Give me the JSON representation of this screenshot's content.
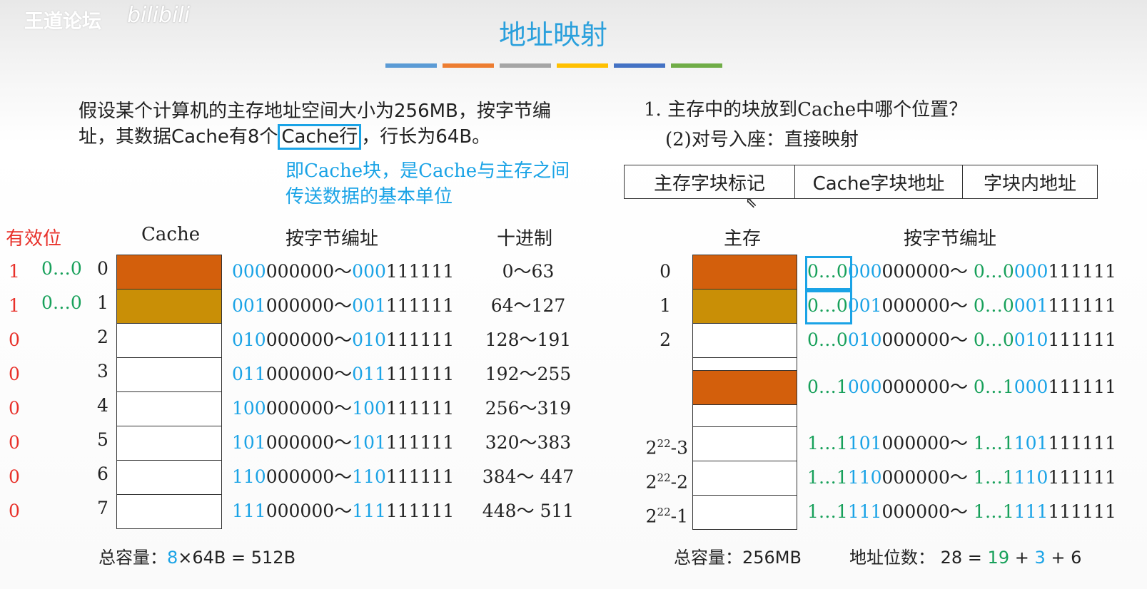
{
  "watermark": {
    "site": "王道论坛",
    "logo": "bilibili"
  },
  "title": "地址映射",
  "colors": {
    "blue": "#1aa3e6",
    "green": "#17a05a",
    "red": "#e8312a",
    "orange": "#d35f0c",
    "gold": "#c98f06",
    "bars": [
      "#5b9bd5",
      "#ed7d31",
      "#a5a5a5",
      "#ffc000",
      "#4472c4",
      "#70ad47"
    ]
  },
  "intro": {
    "line1": "假设某个计算机的主存地址空间大小为256MB，按字节编",
    "line2_pre": "址，其数据Cache有8个",
    "line2_hl": "Cache行",
    "line2_post": "，行长为64B。"
  },
  "note": {
    "line1": "即Cache块，是Cache与主存之间",
    "line2": "传送数据的基本单位"
  },
  "question": {
    "q1": "1. 主存中的块放到Cache中哪个位置？",
    "q2": "(2)对号入座：直接映射"
  },
  "format": [
    "主存字块标记",
    "Cache字块地址",
    "字块内地址"
  ],
  "left_headers": {
    "valid": "有效位",
    "cache": "Cache",
    "addr": "按字节编址",
    "dec": "十进制"
  },
  "cache_rows": [
    {
      "valid": "1",
      "tag": "0…0",
      "idx": "0",
      "fill": "orange",
      "a": [
        [
          "000",
          "b"
        ],
        [
          "000000",
          "k"
        ]
      ],
      "b": [
        [
          "000",
          "b"
        ],
        [
          "111111",
          "k"
        ]
      ],
      "dec": "0～63"
    },
    {
      "valid": "1",
      "tag": "0…0",
      "idx": "1",
      "fill": "gold",
      "a": [
        [
          "001",
          "b"
        ],
        [
          "000000",
          "k"
        ]
      ],
      "b": [
        [
          "001",
          "b"
        ],
        [
          "111111",
          "k"
        ]
      ],
      "dec": "64～127"
    },
    {
      "valid": "0",
      "tag": "",
      "idx": "2",
      "fill": "",
      "a": [
        [
          "010",
          "b"
        ],
        [
          "000000",
          "k"
        ]
      ],
      "b": [
        [
          "010",
          "b"
        ],
        [
          "111111",
          "k"
        ]
      ],
      "dec": "128～191"
    },
    {
      "valid": "0",
      "tag": "",
      "idx": "3",
      "fill": "",
      "a": [
        [
          "011",
          "b"
        ],
        [
          "000000",
          "k"
        ]
      ],
      "b": [
        [
          "011",
          "b"
        ],
        [
          "111111",
          "k"
        ]
      ],
      "dec": "192～255"
    },
    {
      "valid": "0",
      "tag": "",
      "idx": "4",
      "fill": "",
      "a": [
        [
          "100",
          "b"
        ],
        [
          "000000",
          "k"
        ]
      ],
      "b": [
        [
          "100",
          "b"
        ],
        [
          "111111",
          "k"
        ]
      ],
      "dec": "256～319"
    },
    {
      "valid": "0",
      "tag": "",
      "idx": "5",
      "fill": "",
      "a": [
        [
          "101",
          "b"
        ],
        [
          "000000",
          "k"
        ]
      ],
      "b": [
        [
          "101",
          "b"
        ],
        [
          "111111",
          "k"
        ]
      ],
      "dec": "320～383"
    },
    {
      "valid": "0",
      "tag": "",
      "idx": "6",
      "fill": "",
      "a": [
        [
          "110",
          "b"
        ],
        [
          "000000",
          "k"
        ]
      ],
      "b": [
        [
          "110",
          "b"
        ],
        [
          "111111",
          "k"
        ]
      ],
      "dec": "384～ 447"
    },
    {
      "valid": "0",
      "tag": "",
      "idx": "7",
      "fill": "",
      "a": [
        [
          "111",
          "b"
        ],
        [
          "000000",
          "k"
        ]
      ],
      "b": [
        [
          "111",
          "b"
        ],
        [
          "111111",
          "k"
        ]
      ],
      "dec": "448～ 511"
    }
  ],
  "right_headers": {
    "mem": "主存",
    "addr": "按字节编址"
  },
  "mem_rows": [
    {
      "label": "0",
      "fill": "orange",
      "a": [
        [
          "0…0",
          "g"
        ],
        [
          "000",
          "b"
        ],
        [
          "000000",
          "k"
        ]
      ],
      "b": [
        [
          "0…0",
          "g"
        ],
        [
          "000",
          "b"
        ],
        [
          "111111",
          "k"
        ]
      ],
      "boxed": true
    },
    {
      "label": "1",
      "fill": "gold",
      "a": [
        [
          "0…0",
          "g"
        ],
        [
          "001",
          "b"
        ],
        [
          "000000",
          "k"
        ]
      ],
      "b": [
        [
          "0…0",
          "g"
        ],
        [
          "001",
          "b"
        ],
        [
          "111111",
          "k"
        ]
      ],
      "boxed": true
    },
    {
      "label": "2",
      "fill": "",
      "a": [
        [
          "0…0",
          "g"
        ],
        [
          "010",
          "b"
        ],
        [
          "000000",
          "k"
        ]
      ],
      "b": [
        [
          "0…0",
          "g"
        ],
        [
          "010",
          "b"
        ],
        [
          "111111",
          "k"
        ]
      ]
    },
    {
      "label": "",
      "fill": "orange",
      "a": [
        [
          "0…1",
          "g"
        ],
        [
          "000",
          "b"
        ],
        [
          "000000",
          "k"
        ]
      ],
      "b": [
        [
          "0…1",
          "g"
        ],
        [
          "000",
          "b"
        ],
        [
          "111111",
          "k"
        ]
      ]
    },
    {
      "label": "2^22-3",
      "base": "2",
      "exp": "22",
      "suf": "-3",
      "fill": "",
      "a": [
        [
          "1…1",
          "g"
        ],
        [
          "101",
          "b"
        ],
        [
          "000000",
          "k"
        ]
      ],
      "b": [
        [
          "1…1",
          "g"
        ],
        [
          "101",
          "b"
        ],
        [
          "111111",
          "k"
        ]
      ]
    },
    {
      "label": "2^22-2",
      "base": "2",
      "exp": "22",
      "suf": "-2",
      "fill": "",
      "a": [
        [
          "1…1",
          "g"
        ],
        [
          "110",
          "b"
        ],
        [
          "000000",
          "k"
        ]
      ],
      "b": [
        [
          "1…1",
          "g"
        ],
        [
          "110",
          "b"
        ],
        [
          "111111",
          "k"
        ]
      ]
    },
    {
      "label": "2^22-1",
      "base": "2",
      "exp": "22",
      "suf": "-1",
      "fill": "",
      "a": [
        [
          "1…1",
          "g"
        ],
        [
          "111",
          "b"
        ],
        [
          "000000",
          "k"
        ]
      ],
      "b": [
        [
          "1…1",
          "g"
        ],
        [
          "111",
          "b"
        ],
        [
          "111111",
          "k"
        ]
      ]
    }
  ],
  "footer_left": {
    "label": "总容量：",
    "n": "8",
    "rest": "×64B = 512B"
  },
  "footer_right": {
    "cap": "总容量：256MB",
    "bits_label": "地址位数：",
    "total": "28 = ",
    "tag": "19",
    "p1": " + ",
    "idx": "3",
    "p2": " + ",
    "off": "6"
  }
}
